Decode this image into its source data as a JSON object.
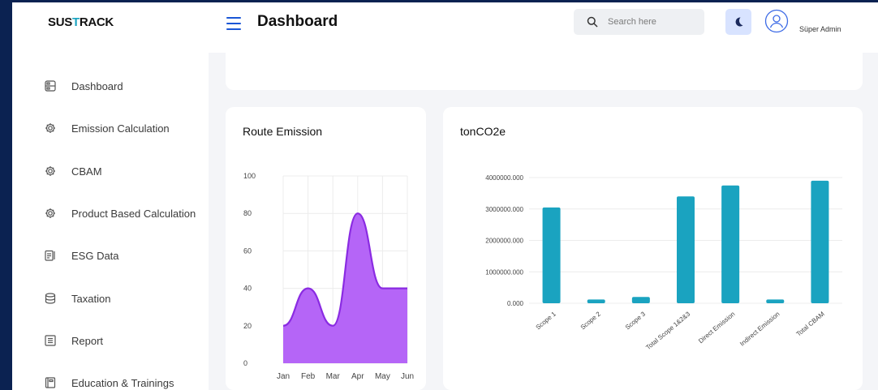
{
  "sidebar": {
    "logo_prefix": "SUS",
    "logo_accent": "T",
    "logo_suffix": "RACK",
    "items": [
      {
        "label": "Dashboard",
        "icon": "dashboard-icon"
      },
      {
        "label": "Emission Calculation",
        "icon": "gear-icon"
      },
      {
        "label": "CBAM",
        "icon": "gear-icon"
      },
      {
        "label": "Product Based Calculation",
        "icon": "gear-icon"
      },
      {
        "label": "ESG Data",
        "icon": "clipboard-icon"
      },
      {
        "label": "Taxation",
        "icon": "database-icon"
      },
      {
        "label": "Report",
        "icon": "list-icon"
      },
      {
        "label": "Education & Trainings",
        "icon": "book-icon"
      }
    ]
  },
  "header": {
    "title": "Dashboard",
    "search_placeholder": "Search here",
    "user_name": "Süper Admin"
  },
  "colors": {
    "background": "#0b2251",
    "accent": "#1a56d6",
    "area_fill": "#b565f7",
    "area_stroke": "#8a2be2",
    "bar": "#1aa3c0"
  },
  "chart_data": [
    {
      "type": "area",
      "title": "Route Emission",
      "categories": [
        "Jan",
        "Feb",
        "Mar",
        "Apr",
        "May",
        "Jun"
      ],
      "values": [
        20,
        40,
        20,
        80,
        40,
        40
      ],
      "ylim": [
        0,
        100
      ],
      "yticks": [
        "0",
        "20",
        "40",
        "60",
        "80",
        "100"
      ],
      "grid": true
    },
    {
      "type": "bar",
      "title": "tonCO2e",
      "categories": [
        "Scope 1",
        "Scope 2",
        "Scope 3",
        "Total Scope 1&2&3",
        "Direct Emission",
        "Indirect Emission",
        "Total CBAM"
      ],
      "values": [
        3050000,
        120000,
        200000,
        3400000,
        3750000,
        120000,
        3900000
      ],
      "ylim": [
        0,
        4000000
      ],
      "yticks": [
        "0.000",
        "1000000.000",
        "2000000.000",
        "3000000.000",
        "4000000.000"
      ],
      "grid": true
    }
  ]
}
